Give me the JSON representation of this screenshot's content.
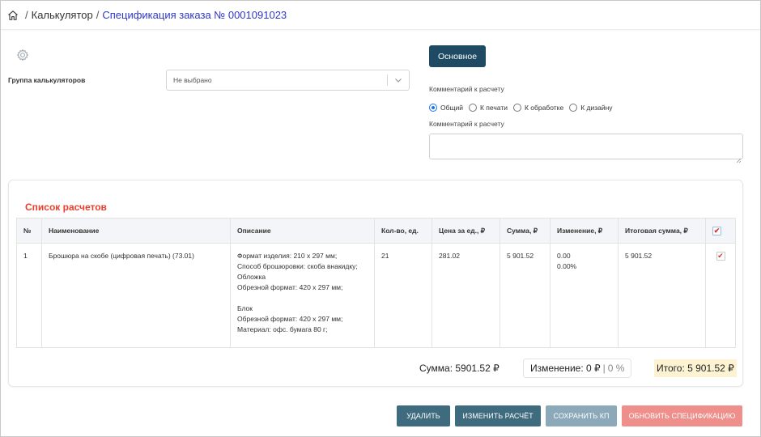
{
  "breadcrumb": {
    "home_icon": "home-icon",
    "items": [
      "Калькулятор",
      "Спецификация заказа № 0001091023"
    ],
    "separator": "/"
  },
  "settings": {
    "gear_icon": "gear-icon",
    "group_label": "Группа калькуляторов",
    "group_value": "Не выбрано"
  },
  "right_panel": {
    "main_button": "Основное",
    "comment_label": "Комментарий к расчету",
    "radios": [
      {
        "label": "Общий",
        "checked": true
      },
      {
        "label": "К печати",
        "checked": false
      },
      {
        "label": "К обработке",
        "checked": false
      },
      {
        "label": "К дизайну",
        "checked": false
      }
    ],
    "comment_label_2": "Комментарий к расчету",
    "comment_value": ""
  },
  "list": {
    "title": "Список расчетов",
    "columns": [
      "№",
      "Наименование",
      "Описание",
      "Кол-во, ед.",
      "Цена за ед., ₽",
      "Сумма, ₽",
      "Изменение, ₽",
      "Итоговая сумма, ₽"
    ],
    "header_checked": true,
    "rows": [
      {
        "num": "1",
        "name": "Брошюра на скобе (цифровая печать) (73.01)",
        "description": [
          "Формат изделия: 210 x 297 мм;",
          "Способ брошюровки: скоба внакидку;",
          "Обложка",
          "Обрезной формат: 420 x 297 мм;",
          "",
          "Блок",
          "Обрезной формат: 420 x 297 мм;",
          "Материал: офс. бумага 80 г;"
        ],
        "qty": "21",
        "price": "281.02",
        "sum": "5 901.52",
        "change": "0.00",
        "change_pct": "0.00%",
        "total": "5 901.52",
        "checked": true
      }
    ]
  },
  "totals": {
    "sum": "Сумма: 5901.52 ₽",
    "change": "Изменение: 0 ₽",
    "change_sep": "|",
    "change_pct": "0 %",
    "itogo": "Итого: 5 901.52 ₽"
  },
  "actions": {
    "delete": "Удалить",
    "edit": "Изменить расчёт",
    "save_kp": "Сохранить КП",
    "update": "Обновить спецификацию"
  },
  "colors": {
    "accent_link": "#2f37c9",
    "primary_button": "#1e4a63",
    "title_red": "#e8402c",
    "itogo_bg": "#fdf3d3"
  }
}
